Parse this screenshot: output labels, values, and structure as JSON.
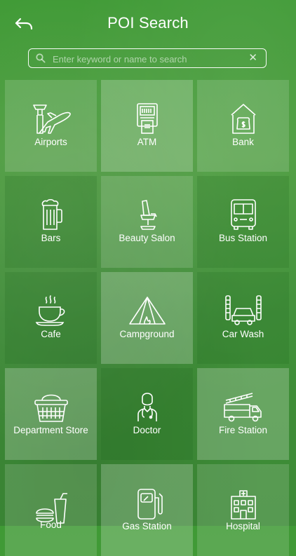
{
  "header": {
    "title": "POI Search",
    "back_icon": "back-arrow-icon"
  },
  "search": {
    "placeholder": "Enter keyword or name to search",
    "value": ""
  },
  "categories": [
    {
      "label": "Airports",
      "icon": "airport-icon"
    },
    {
      "label": "ATM",
      "icon": "atm-icon"
    },
    {
      "label": "Bank",
      "icon": "bank-icon"
    },
    {
      "label": "Bars",
      "icon": "beer-mug-icon"
    },
    {
      "label": "Beauty Salon",
      "icon": "salon-chair-icon"
    },
    {
      "label": "Bus Station",
      "icon": "bus-icon"
    },
    {
      "label": "Cafe",
      "icon": "coffee-cup-icon"
    },
    {
      "label": "Campground",
      "icon": "tent-icon"
    },
    {
      "label": "Car Wash",
      "icon": "car-wash-icon"
    },
    {
      "label": "Department Store",
      "icon": "basket-icon"
    },
    {
      "label": "Doctor",
      "icon": "doctor-icon"
    },
    {
      "label": "Fire Station",
      "icon": "fire-truck-icon"
    },
    {
      "label": "Food",
      "icon": "food-icon"
    },
    {
      "label": "Gas Station",
      "icon": "gas-pump-icon"
    },
    {
      "label": "Hospital",
      "icon": "hospital-icon"
    }
  ],
  "colors": {
    "accent": "#ffffff",
    "background": "#4a9b3c"
  }
}
